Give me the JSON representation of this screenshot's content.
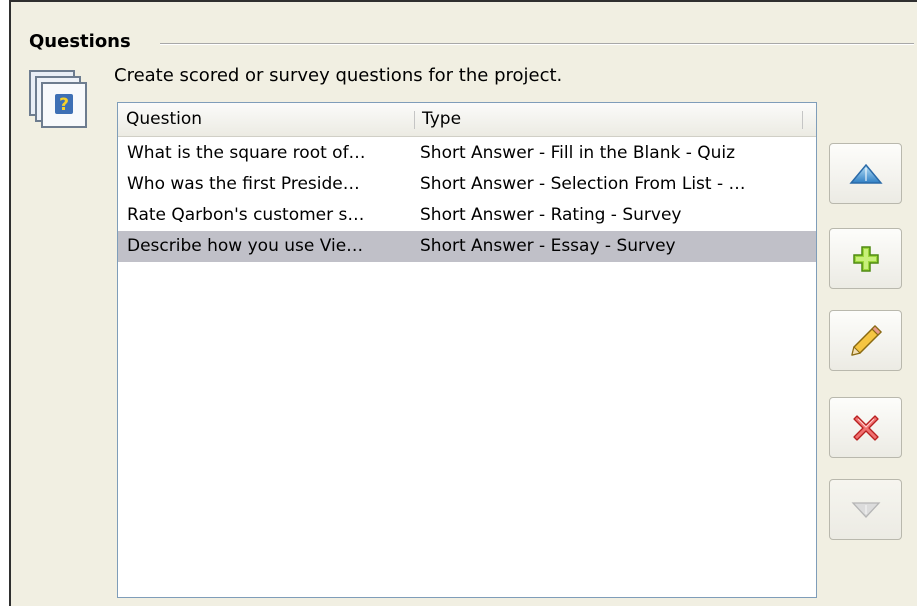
{
  "section": {
    "title": "Questions",
    "description": "Create scored or survey questions for the project."
  },
  "icons": {
    "questions": "questions-stack-icon",
    "move_up": "triangle-up-icon",
    "add": "plus-icon",
    "edit": "pencil-icon",
    "delete": "x-icon",
    "move_down": "triangle-down-icon"
  },
  "table": {
    "headers": {
      "question": "Question",
      "type": "Type"
    },
    "rows": [
      {
        "question": "What is the square root of…",
        "type": "Short Answer -  Fill in the Blank - Quiz",
        "selected": false
      },
      {
        "question": "Who was the first Preside…",
        "type": "Short Answer - Selection From List - …",
        "selected": false
      },
      {
        "question": "Rate Qarbon's customer s…",
        "type": "Short Answer - Rating - Survey",
        "selected": false
      },
      {
        "question": "Describe how you use Vie…",
        "type": "Short Answer - Essay - Survey",
        "selected": true
      }
    ]
  },
  "buttons": {
    "move_up": {
      "enabled": true
    },
    "add": {
      "enabled": true
    },
    "edit": {
      "enabled": true
    },
    "delete": {
      "enabled": true
    },
    "move_down": {
      "enabled": false
    }
  },
  "colors": {
    "panel_bg": "#f1efe2",
    "selection": "#c0c0c8",
    "up_arrow": "#4a9fd6",
    "add_plus": "#8ccf2c",
    "delete_x": "#e24b4b",
    "disabled_arrow": "#c8c8c8"
  }
}
